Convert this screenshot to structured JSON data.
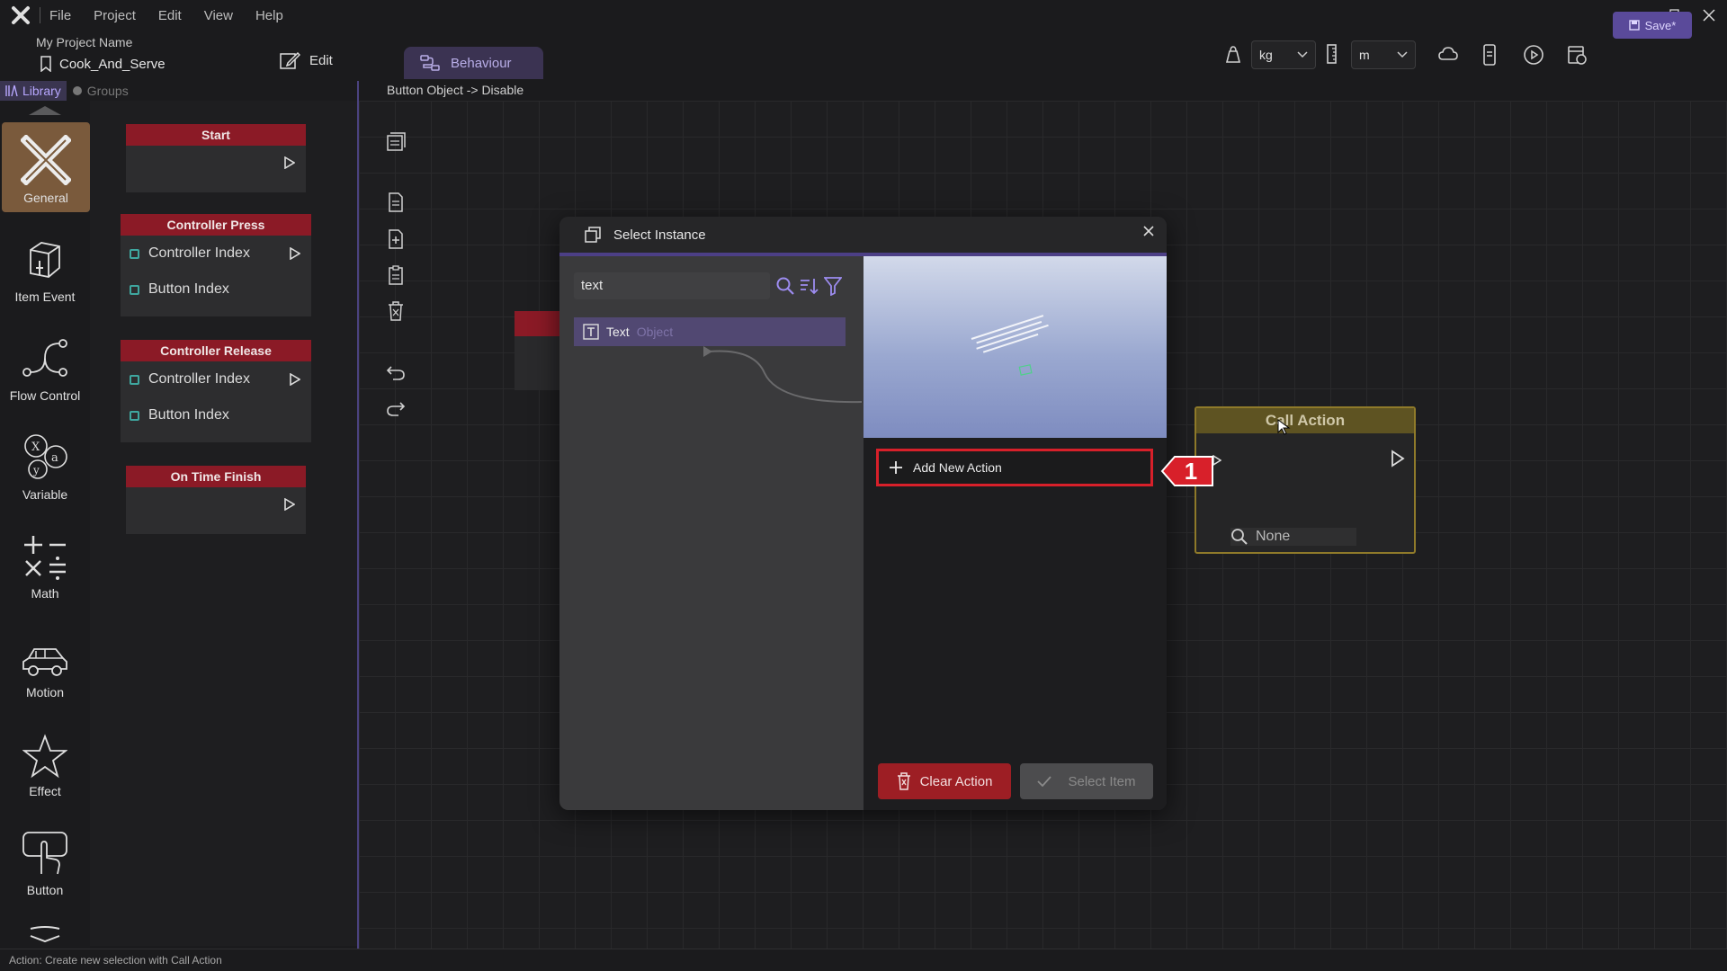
{
  "menubar": {
    "items": [
      "File",
      "Project",
      "Edit",
      "View",
      "Help"
    ]
  },
  "project": {
    "name_label": "My Project Name",
    "file_name": "Cook_And_Serve",
    "edit_tab": "Edit",
    "behaviour_tab": "Behaviour"
  },
  "toolbar": {
    "weight_unit": "kg",
    "length_unit": "m",
    "save_label": "Save*"
  },
  "library": {
    "tabs": [
      "Library",
      "Groups"
    ],
    "categories": [
      "General",
      "Item Event",
      "Flow Control",
      "Variable",
      "Math",
      "Motion",
      "Effect",
      "Button"
    ],
    "nodes": [
      {
        "title": "Start",
        "rows": []
      },
      {
        "title": "Controller Press",
        "rows": [
          "Controller Index",
          "Button Index"
        ]
      },
      {
        "title": "Controller Release",
        "rows": [
          "Controller Index",
          "Button Index"
        ]
      },
      {
        "title": "On Time Finish",
        "rows": []
      }
    ]
  },
  "canvas": {
    "breadcrumb": "Button Object -> Disable",
    "call_action": {
      "title": "Call Action",
      "field_value": "None"
    }
  },
  "dialog": {
    "title": "Select Instance",
    "search_value": "text",
    "list": [
      {
        "name": "Text",
        "type": "Object"
      }
    ],
    "add_action_label": "Add New Action",
    "clear_action_label": "Clear Action",
    "select_item_label": "Select Item"
  },
  "callout": {
    "number": "1",
    "color": "#d8202a"
  },
  "status": {
    "text": "Action: Create new selection with Call Action"
  },
  "colors": {
    "accent": "#5a4a9a",
    "node_header": "#8b1a26",
    "call_action_border": "#8f7a2a"
  }
}
